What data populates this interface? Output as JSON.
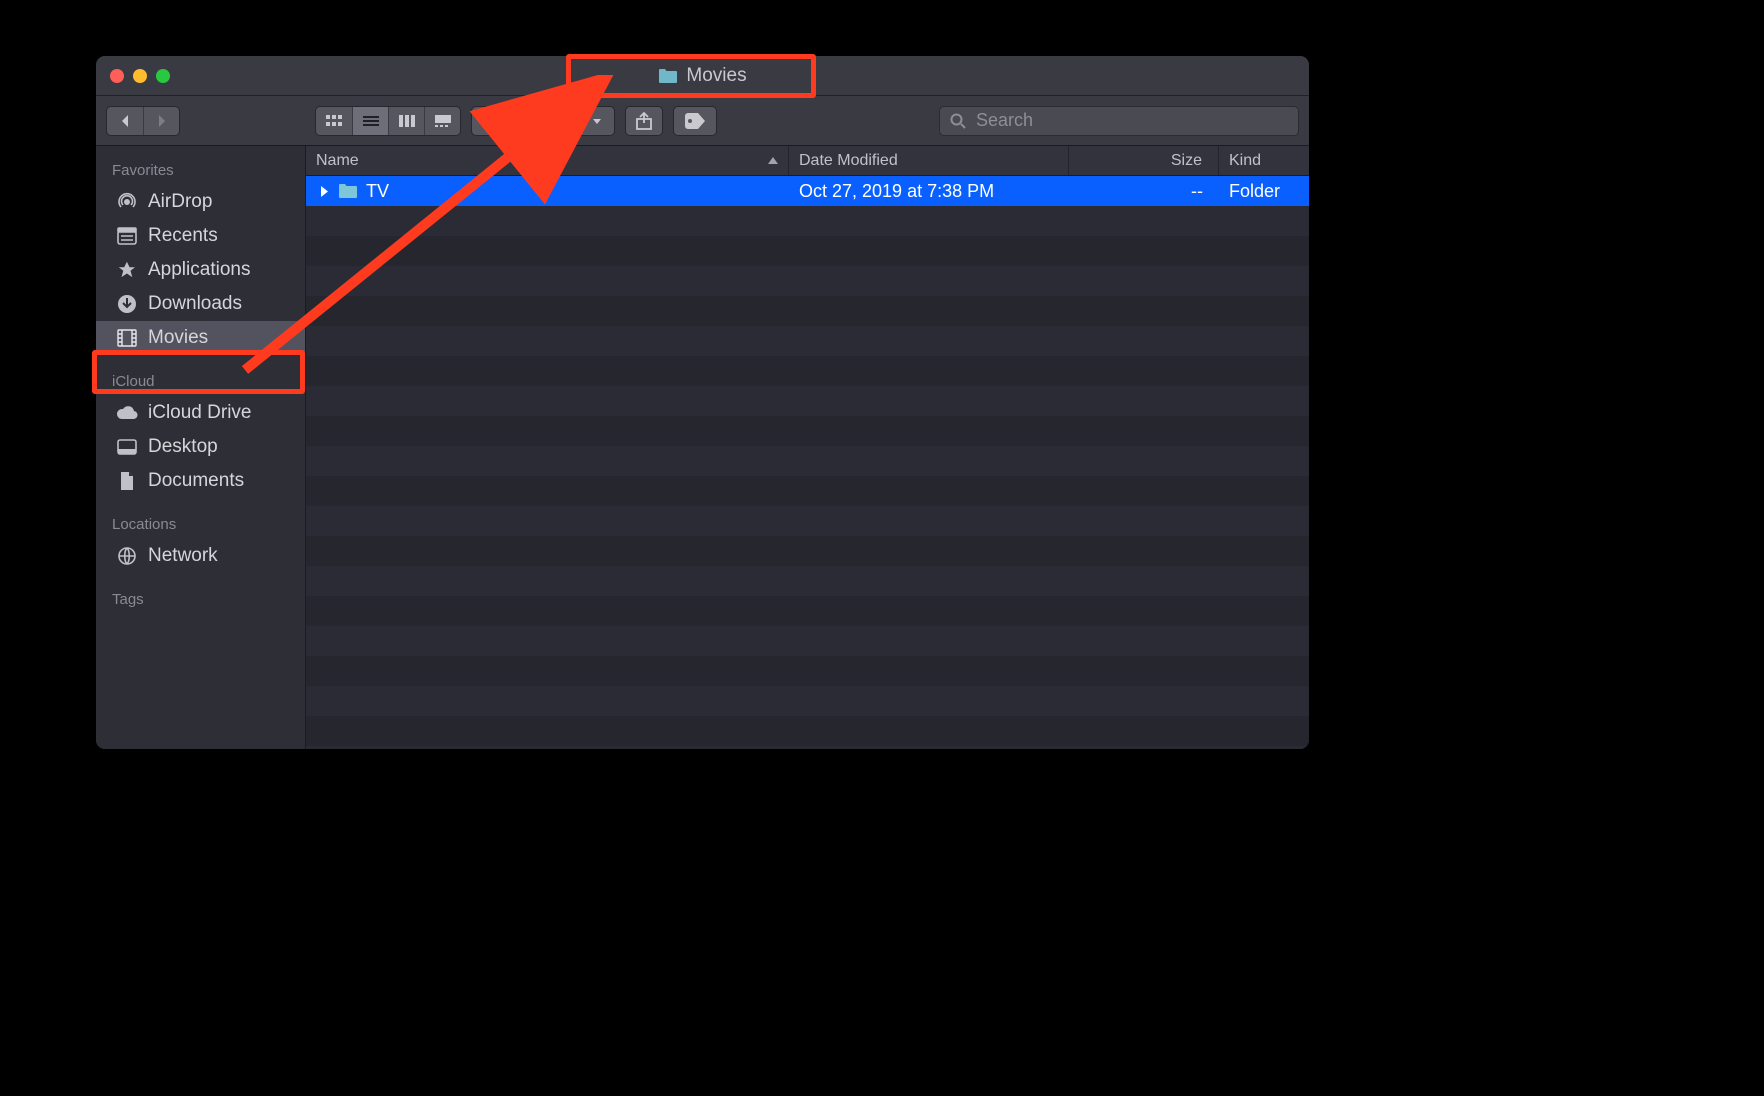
{
  "window": {
    "title": "Movies"
  },
  "toolbar": {},
  "search": {
    "placeholder": "Search"
  },
  "sidebar": {
    "sections": [
      {
        "header": "Favorites",
        "items": [
          {
            "icon": "airdrop",
            "label": "AirDrop"
          },
          {
            "icon": "recents",
            "label": "Recents"
          },
          {
            "icon": "apps",
            "label": "Applications"
          },
          {
            "icon": "downloads",
            "label": "Downloads"
          },
          {
            "icon": "movies",
            "label": "Movies",
            "selected": true
          }
        ]
      },
      {
        "header": "iCloud",
        "items": [
          {
            "icon": "cloud",
            "label": "iCloud Drive"
          },
          {
            "icon": "desktop",
            "label": "Desktop"
          },
          {
            "icon": "docs",
            "label": "Documents"
          }
        ]
      },
      {
        "header": "Locations",
        "items": [
          {
            "icon": "network",
            "label": "Network"
          }
        ]
      },
      {
        "header": "Tags",
        "items": []
      }
    ]
  },
  "columns": {
    "name": "Name",
    "date": "Date Modified",
    "size": "Size",
    "kind": "Kind"
  },
  "files": [
    {
      "name": "TV",
      "date": "Oct 27, 2019 at 7:38 PM",
      "size": "--",
      "kind": "Folder",
      "selected": true
    }
  ]
}
